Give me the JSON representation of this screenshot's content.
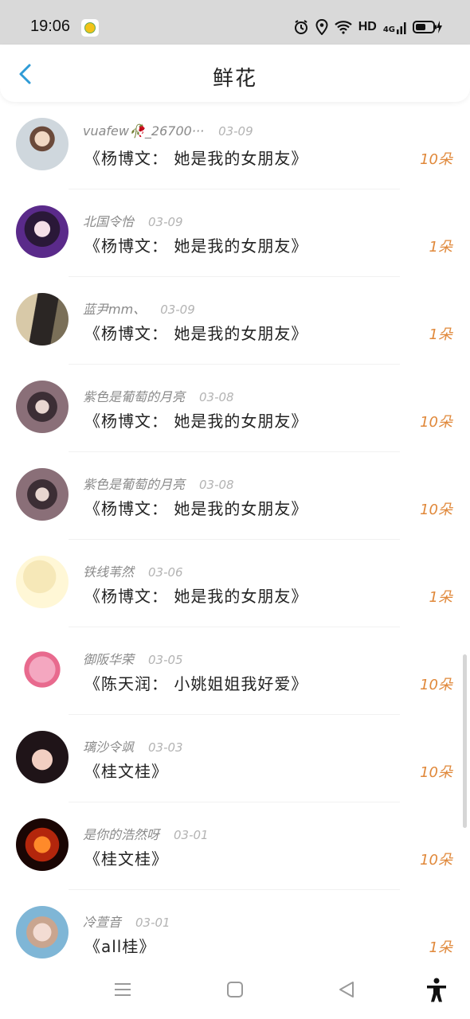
{
  "status_bar": {
    "time": "19:06",
    "hd": "HD",
    "network": "4G"
  },
  "header": {
    "title": "鲜花",
    "back_icon": "chevron-left-icon"
  },
  "colors": {
    "accent": "#2e9bd6",
    "count": "#e0883a",
    "username": "#8a8a8a",
    "date": "#b3b3b3"
  },
  "list": [
    {
      "name": "vuafew🥀_26700···",
      "date": "03-09",
      "song": "《杨博文： 她是我的女朋友》",
      "count": "10朵"
    },
    {
      "name": "北国令怡",
      "date": "03-09",
      "song": "《杨博文： 她是我的女朋友》",
      "count": "1朵"
    },
    {
      "name": "蓝尹mm、",
      "date": "03-09",
      "song": "《杨博文： 她是我的女朋友》",
      "count": "1朵"
    },
    {
      "name": "紫色是葡萄的月亮",
      "date": "03-08",
      "song": "《杨博文： 她是我的女朋友》",
      "count": "10朵"
    },
    {
      "name": "紫色是葡萄的月亮",
      "date": "03-08",
      "song": "《杨博文： 她是我的女朋友》",
      "count": "10朵"
    },
    {
      "name": "铁线苇然",
      "date": "03-06",
      "song": "《杨博文： 她是我的女朋友》",
      "count": "1朵"
    },
    {
      "name": "御阪华荣",
      "date": "03-05",
      "song": "《陈天润： 小姚姐姐我好爱》",
      "count": "10朵"
    },
    {
      "name": "璃沙令飒",
      "date": "03-03",
      "song": "《桂文桂》",
      "count": "10朵"
    },
    {
      "name": "是你的浩然呀",
      "date": "03-01",
      "song": "《桂文桂》",
      "count": "10朵"
    },
    {
      "name": "冷萱音",
      "date": "03-01",
      "song": "《all桂》",
      "count": "1朵"
    }
  ],
  "bottom_nav": [
    "menu-icon",
    "home-square-icon",
    "back-triangle-icon",
    "accessibility-icon"
  ]
}
